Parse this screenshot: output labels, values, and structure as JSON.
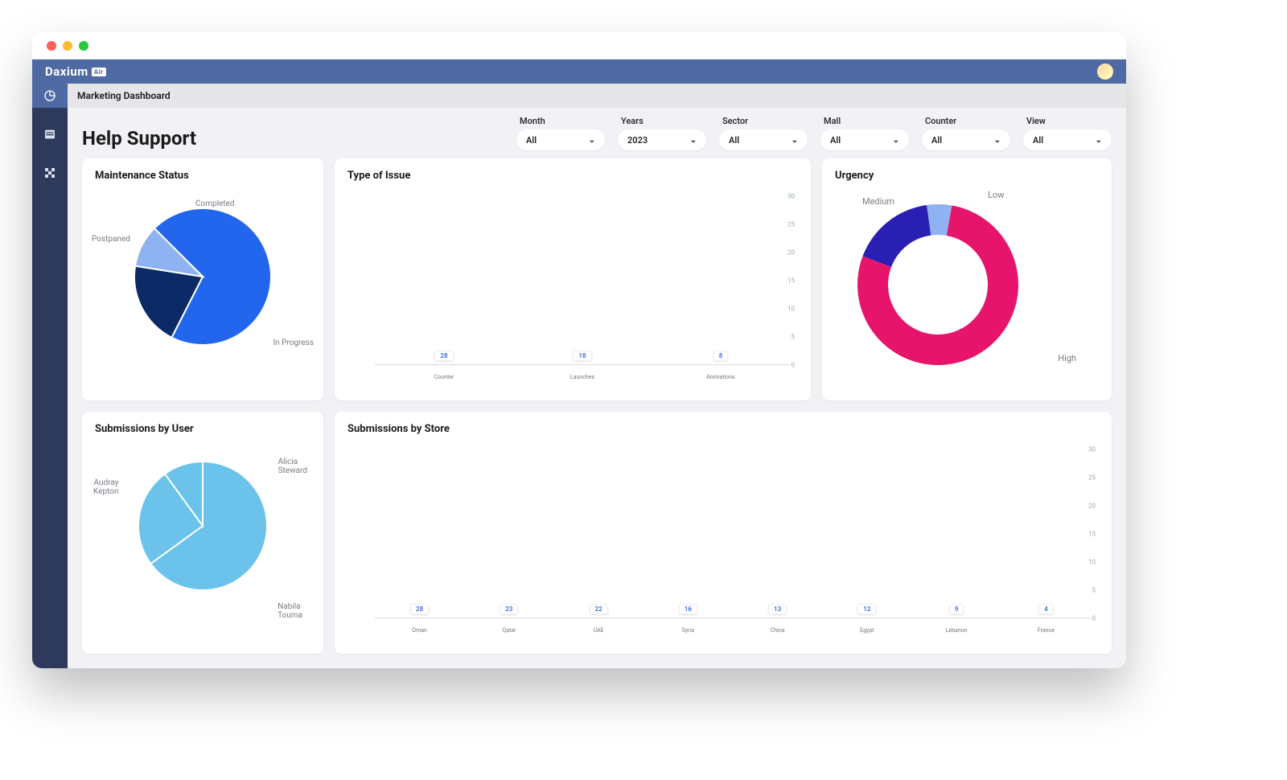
{
  "brand": {
    "name": "Daxium",
    "suffix": "Air"
  },
  "nav": {
    "items": [
      {
        "id": "dashboards",
        "active": true
      },
      {
        "id": "tables",
        "active": false
      },
      {
        "id": "apps",
        "active": false
      }
    ]
  },
  "tab": {
    "label": "Marketing Dashboard"
  },
  "page": {
    "title": "Help Support"
  },
  "filters": [
    {
      "key": "month",
      "label": "Month",
      "value": "All"
    },
    {
      "key": "years",
      "label": "Years",
      "value": "2023"
    },
    {
      "key": "sector",
      "label": "Sector",
      "value": "All"
    },
    {
      "key": "mall",
      "label": "Mall",
      "value": "All"
    },
    {
      "key": "counter",
      "label": "Counter",
      "value": "All"
    },
    {
      "key": "view",
      "label": "View",
      "value": "All"
    }
  ],
  "cards": {
    "maintenance": {
      "title": "Maintenance Status"
    },
    "issue": {
      "title": "Type of Issue"
    },
    "urgency": {
      "title": "Urgency"
    },
    "byuser": {
      "title": "Submissions by User"
    },
    "bystore": {
      "title": "Submissions by Store"
    }
  },
  "chart_data": [
    {
      "id": "maintenance_status",
      "type": "pie",
      "title": "Maintenance Status",
      "series": [
        {
          "name": "In Progress",
          "value": 70,
          "color": "#2266ee"
        },
        {
          "name": "Postpaned",
          "value": 20,
          "color": "#0b2a66"
        },
        {
          "name": "Completed",
          "value": 10,
          "color": "#8fb2f2"
        }
      ]
    },
    {
      "id": "type_of_issue",
      "type": "bar",
      "title": "Type of Issue",
      "categories": [
        "Counter",
        "Launches",
        "Animations"
      ],
      "values": [
        28,
        18,
        8
      ],
      "ylim": [
        0,
        30
      ],
      "yticks": [
        0,
        5,
        10,
        15,
        20,
        25,
        30
      ]
    },
    {
      "id": "urgency",
      "type": "pie",
      "subtype": "donut",
      "title": "Urgency",
      "series": [
        {
          "name": "High",
          "value": 78,
          "color": "#e6146a"
        },
        {
          "name": "Medium",
          "value": 17,
          "color": "#2a1fb3"
        },
        {
          "name": "Low",
          "value": 5,
          "color": "#8fb2f2"
        }
      ]
    },
    {
      "id": "submissions_by_user",
      "type": "pie",
      "title": "Submissions by User",
      "series": [
        {
          "name": "Nabila Touma",
          "value": 65,
          "color": "#6bc3ec"
        },
        {
          "name": "Audray Kepton",
          "value": 25,
          "color": "#6bc3ec"
        },
        {
          "name": "Alicia Steward",
          "value": 10,
          "color": "#6bc3ec"
        }
      ]
    },
    {
      "id": "submissions_by_store",
      "type": "bar",
      "title": "Submissions by Store",
      "categories": [
        "Oman",
        "Qatar",
        "UAE",
        "Syria",
        "China",
        "Egypt",
        "Lebanon",
        "France"
      ],
      "values": [
        28,
        23,
        22,
        16,
        13,
        12,
        9,
        4
      ],
      "ylim": [
        0,
        30
      ],
      "yticks": [
        0,
        5,
        10,
        15,
        20,
        25,
        30
      ]
    }
  ]
}
